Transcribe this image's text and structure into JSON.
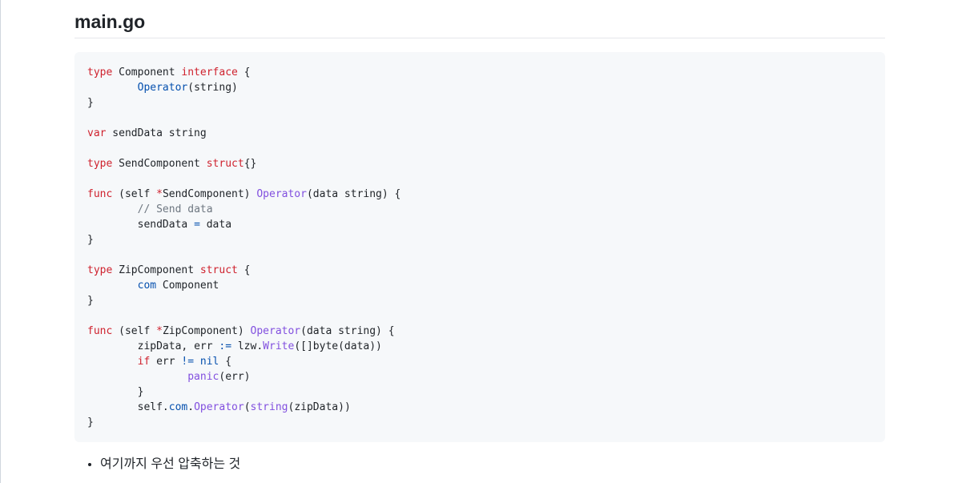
{
  "page": {
    "title": "main.go"
  },
  "code": {
    "language": "go",
    "lines": [
      [
        {
          "t": "type",
          "c": "keyword"
        },
        {
          "t": " Component ",
          "c": "plain"
        },
        {
          "t": "interface",
          "c": "keyword"
        },
        {
          "t": " {",
          "c": "plain"
        }
      ],
      [
        {
          "t": "\t",
          "c": "plain"
        },
        {
          "t": "Operator",
          "c": "type"
        },
        {
          "t": "(string)",
          "c": "plain"
        }
      ],
      [
        {
          "t": "}",
          "c": "plain"
        }
      ],
      [],
      [
        {
          "t": "var",
          "c": "keyword"
        },
        {
          "t": " sendData string",
          "c": "plain"
        }
      ],
      [],
      [
        {
          "t": "type",
          "c": "keyword"
        },
        {
          "t": " SendComponent ",
          "c": "plain"
        },
        {
          "t": "struct",
          "c": "keyword"
        },
        {
          "t": "{}",
          "c": "plain"
        }
      ],
      [],
      [
        {
          "t": "func",
          "c": "keyword"
        },
        {
          "t": " (self ",
          "c": "plain"
        },
        {
          "t": "*",
          "c": "keyword"
        },
        {
          "t": "SendComponent) ",
          "c": "plain"
        },
        {
          "t": "Operator",
          "c": "func"
        },
        {
          "t": "(data string) {",
          "c": "plain"
        }
      ],
      [
        {
          "t": "\t",
          "c": "plain"
        },
        {
          "t": "// Send data",
          "c": "comment"
        }
      ],
      [
        {
          "t": "\tsendData ",
          "c": "plain"
        },
        {
          "t": "=",
          "c": "op"
        },
        {
          "t": " data",
          "c": "plain"
        }
      ],
      [
        {
          "t": "}",
          "c": "plain"
        }
      ],
      [],
      [
        {
          "t": "type",
          "c": "keyword"
        },
        {
          "t": " ZipComponent ",
          "c": "plain"
        },
        {
          "t": "struct",
          "c": "keyword"
        },
        {
          "t": " {",
          "c": "plain"
        }
      ],
      [
        {
          "t": "\t",
          "c": "plain"
        },
        {
          "t": "com",
          "c": "type"
        },
        {
          "t": " Component",
          "c": "plain"
        }
      ],
      [
        {
          "t": "}",
          "c": "plain"
        }
      ],
      [],
      [
        {
          "t": "func",
          "c": "keyword"
        },
        {
          "t": " (self ",
          "c": "plain"
        },
        {
          "t": "*",
          "c": "keyword"
        },
        {
          "t": "ZipComponent) ",
          "c": "plain"
        },
        {
          "t": "Operator",
          "c": "func"
        },
        {
          "t": "(data string) {",
          "c": "plain"
        }
      ],
      [
        {
          "t": "\tzipData, err ",
          "c": "plain"
        },
        {
          "t": ":=",
          "c": "op"
        },
        {
          "t": " lzw.",
          "c": "plain"
        },
        {
          "t": "Write",
          "c": "func"
        },
        {
          "t": "([]byte(data))",
          "c": "plain"
        }
      ],
      [
        {
          "t": "\t",
          "c": "plain"
        },
        {
          "t": "if",
          "c": "keyword"
        },
        {
          "t": " err ",
          "c": "plain"
        },
        {
          "t": "!=",
          "c": "op"
        },
        {
          "t": " ",
          "c": "plain"
        },
        {
          "t": "nil",
          "c": "type"
        },
        {
          "t": " {",
          "c": "plain"
        }
      ],
      [
        {
          "t": "\t\t",
          "c": "plain"
        },
        {
          "t": "panic",
          "c": "func"
        },
        {
          "t": "(err)",
          "c": "plain"
        }
      ],
      [
        {
          "t": "\t}",
          "c": "plain"
        }
      ],
      [
        {
          "t": "\tself.",
          "c": "plain"
        },
        {
          "t": "com",
          "c": "type"
        },
        {
          "t": ".",
          "c": "plain"
        },
        {
          "t": "Operator",
          "c": "func"
        },
        {
          "t": "(",
          "c": "plain"
        },
        {
          "t": "string",
          "c": "func"
        },
        {
          "t": "(zipData))",
          "c": "plain"
        }
      ],
      [
        {
          "t": "}",
          "c": "plain"
        }
      ]
    ]
  },
  "notes": [
    "여기까지 우선 압축하는 것"
  ],
  "colors": {
    "keyword": "#cf222e",
    "func": "#8250df",
    "type": "#0550ae",
    "comment": "#6e7781",
    "code_bg": "#f6f8fa"
  }
}
